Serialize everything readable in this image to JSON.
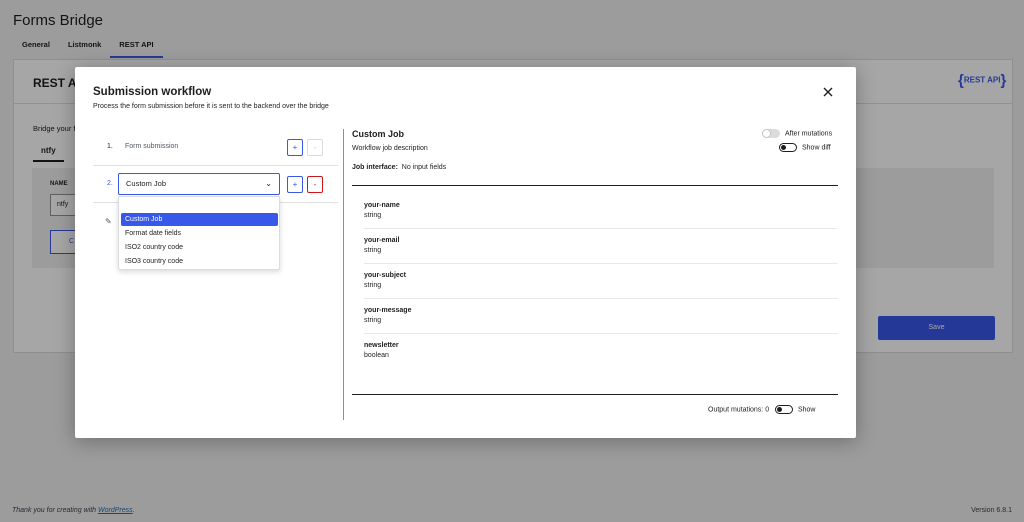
{
  "page": {
    "title": "Forms Bridge",
    "tabs": [
      {
        "label": "General"
      },
      {
        "label": "Listmonk"
      },
      {
        "label": "REST API"
      }
    ],
    "card_title": "REST AP",
    "api_logo": "REST API",
    "bridge_label": "Bridge your f",
    "bridge_tab": "ntfy",
    "name_label": "NAME",
    "name_value": "ntfy",
    "bg_button": "C",
    "save_label": "Save",
    "footer_text": "Thank you for creating with",
    "footer_link": "WordPress",
    "footer_period": ".",
    "version": "Version 6.8.1"
  },
  "modal": {
    "title": "Submission workflow",
    "description": "Process the form submission before it is sent to the backend over the bridge",
    "steps": [
      {
        "num": "1.",
        "label": "Form submission"
      },
      {
        "num": "2.",
        "selected": "Custom Job"
      }
    ],
    "add_symbol": "+",
    "remove_symbol": "-",
    "dropdown_options": [
      "Custom Job",
      "Format date fields",
      "ISO2 country code",
      "ISO3 country code"
    ],
    "job": {
      "title": "Custom Job",
      "description": "Workflow job description",
      "interface_label": "Job interface:",
      "interface_value": "No input fields",
      "after_mutations": "After mutations",
      "show_diff": "Show diff",
      "fields": [
        {
          "name": "your-name",
          "type": "string"
        },
        {
          "name": "your-email",
          "type": "string"
        },
        {
          "name": "your-subject",
          "type": "string"
        },
        {
          "name": "your-message",
          "type": "string"
        },
        {
          "name": "newsletter",
          "type": "boolean"
        }
      ],
      "output_mutations": "Output mutations: 0",
      "show": "Show"
    }
  }
}
